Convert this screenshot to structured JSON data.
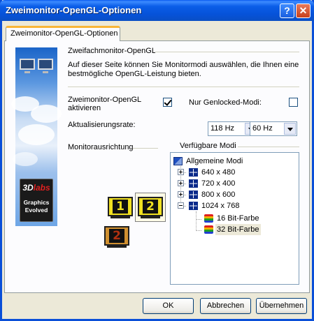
{
  "window": {
    "title": "Zweimonitor-OpenGL-Optionen",
    "help_symbol": "?",
    "close_symbol": "✕"
  },
  "tab": {
    "label": "Zweimonitor-OpenGL-Optionen"
  },
  "branding": {
    "logo_line1": "3D",
    "logo_line1_italic": "labs",
    "logo_line2": "Graphics",
    "logo_line3": "Evolved"
  },
  "section": {
    "heading": "Zweifachmonitor-OpenGL",
    "description_line1": "Auf dieser Seite können Sie Monitormodi auswählen, die Ihnen eine",
    "description_line2": "bestmögliche OpenGL-Leistung bieten."
  },
  "options": {
    "enable_label_line1": "Zweimonitor-OpenGL",
    "enable_label_line2": "aktivieren",
    "enable_checked": true,
    "genlocked_label": "Nur Genlocked-Modi:",
    "genlocked_checked": false,
    "refresh_label": "Aktualisierungsrate:",
    "refresh_value_1": "118 Hz",
    "refresh_value_2": "60 Hz"
  },
  "orientation": {
    "label": "Monitorausrichtung",
    "monitor_1": "1",
    "monitor_2": "2",
    "monitor_3": "2"
  },
  "modes": {
    "label": "Verfügbare Modi",
    "root": "Allgemeine Modi",
    "items": [
      {
        "label": "640 x 480",
        "expanded": false
      },
      {
        "label": "720 x 400",
        "expanded": false
      },
      {
        "label": "800 x 600",
        "expanded": false
      },
      {
        "label": "1024 x 768",
        "expanded": true
      }
    ],
    "children": [
      {
        "label": "16 Bit-Farbe"
      },
      {
        "label": "32 Bit-Farbe",
        "selected": true
      }
    ]
  },
  "buttons": {
    "ok": "OK",
    "cancel": "Abbrechen",
    "apply": "Übernehmen"
  },
  "colors": {
    "titlebar": "#0a5ee8",
    "tab_accent": "#f9b638",
    "dialog_bg": "#ece9d8"
  }
}
